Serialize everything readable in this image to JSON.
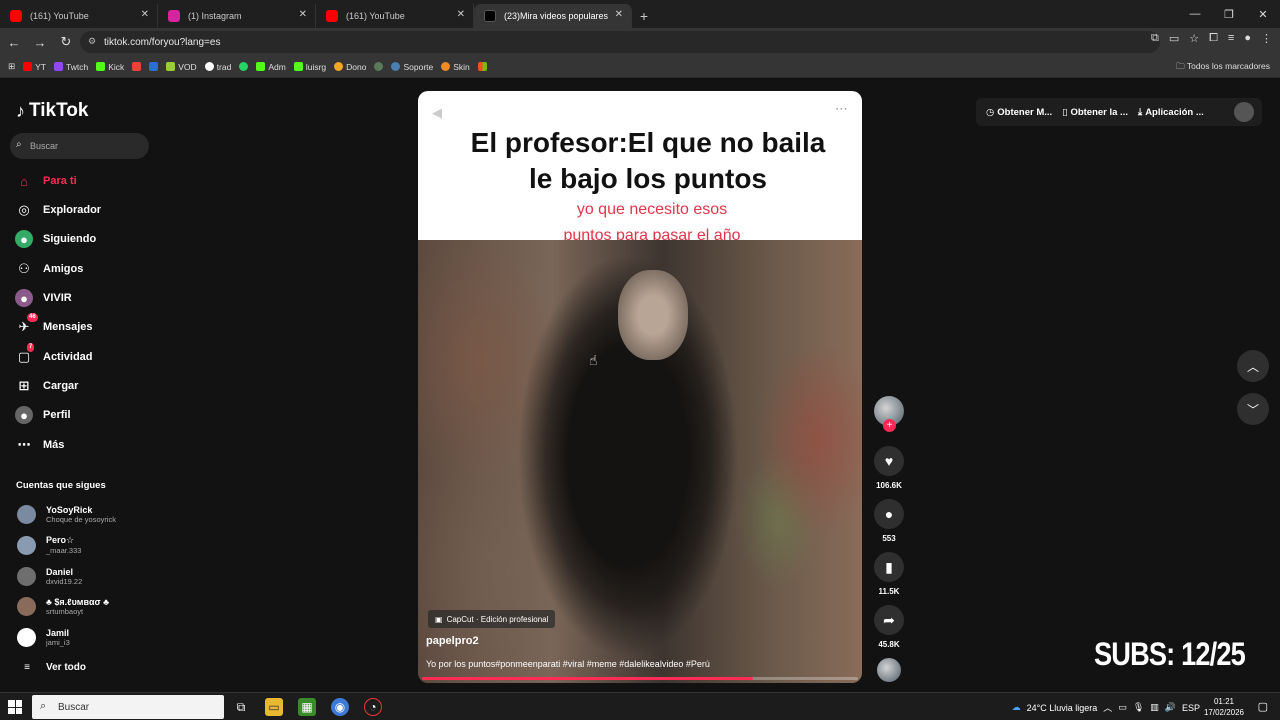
{
  "browser": {
    "tabs": [
      {
        "title": "(161) YouTube",
        "color": "#ff0000"
      },
      {
        "title": "(1) Instagram",
        "color": "#d6249f"
      },
      {
        "title": "(161) YouTube",
        "color": "#ff0000"
      },
      {
        "title": "(23)Mira videos populares sele",
        "color": "#000000",
        "active": true
      }
    ],
    "url": "tiktok.com/foryou?lang=es",
    "bookmarks": [
      "YT",
      "Twtch",
      "Kick",
      "",
      "",
      "VOD",
      "trad",
      "",
      "Adm",
      "luisrg",
      "Dono",
      "",
      "Soporte",
      "Skin",
      ""
    ],
    "bookmarks_right": "Todos los marcadores"
  },
  "tiktok": {
    "logo": "TikTok",
    "search_placeholder": "Buscar",
    "nav": [
      {
        "label": "Para ti",
        "icon": "home-icon",
        "active": true
      },
      {
        "label": "Explorador",
        "icon": "compass-icon"
      },
      {
        "label": "Siguiendo",
        "icon": "following-icon"
      },
      {
        "label": "Amigos",
        "icon": "friends-icon"
      },
      {
        "label": "VIVIR",
        "icon": "live-icon"
      },
      {
        "label": "Mensajes",
        "icon": "messages-icon",
        "badge": "46"
      },
      {
        "label": "Actividad",
        "icon": "activity-icon",
        "badge": "7"
      },
      {
        "label": "Cargar",
        "icon": "upload-icon"
      },
      {
        "label": "Perfil",
        "icon": "profile-icon"
      },
      {
        "label": "Más",
        "icon": "more-icon"
      }
    ],
    "following_title": "Cuentas que sigues",
    "accounts": [
      {
        "name": "YoSoyRick",
        "handle": "Choque de yosoyrick"
      },
      {
        "name": "Pero☆",
        "handle": "_maar.333"
      },
      {
        "name": "Daniel",
        "handle": "dxvid19.22"
      },
      {
        "name": "♣ $я.ℓυмвασ ♣",
        "handle": "srtumbaoyt"
      },
      {
        "name": "Jamil",
        "handle": "jami_i3"
      }
    ],
    "see_all": "Ver todo",
    "topright": [
      "Obtener M...",
      "Obtener la ...",
      "Aplicación ..."
    ]
  },
  "video": {
    "title_line1": "El profesor:El que no baila",
    "title_line2": "le bajo los puntos",
    "subtitle_line1": "yo que necesito esos",
    "subtitle_line2": "puntos para pasar el año",
    "capcut": "CapCut · Edición profesional",
    "author": "papelpro2",
    "caption": "Yo por los puntos#ponmeenparati #viral #meme #dalelikealvideo #Perú",
    "progress": 0.76,
    "likes": "106.6K",
    "comments": "553",
    "saves": "11.5K",
    "shares": "45.8K"
  },
  "overlay": {
    "subs": "SUBS: 12/25"
  },
  "taskbar": {
    "search": "Buscar",
    "weather": "24°C  Lluvia ligera",
    "lang": "ESP",
    "time": "01:21",
    "date": "17/02/2026"
  }
}
